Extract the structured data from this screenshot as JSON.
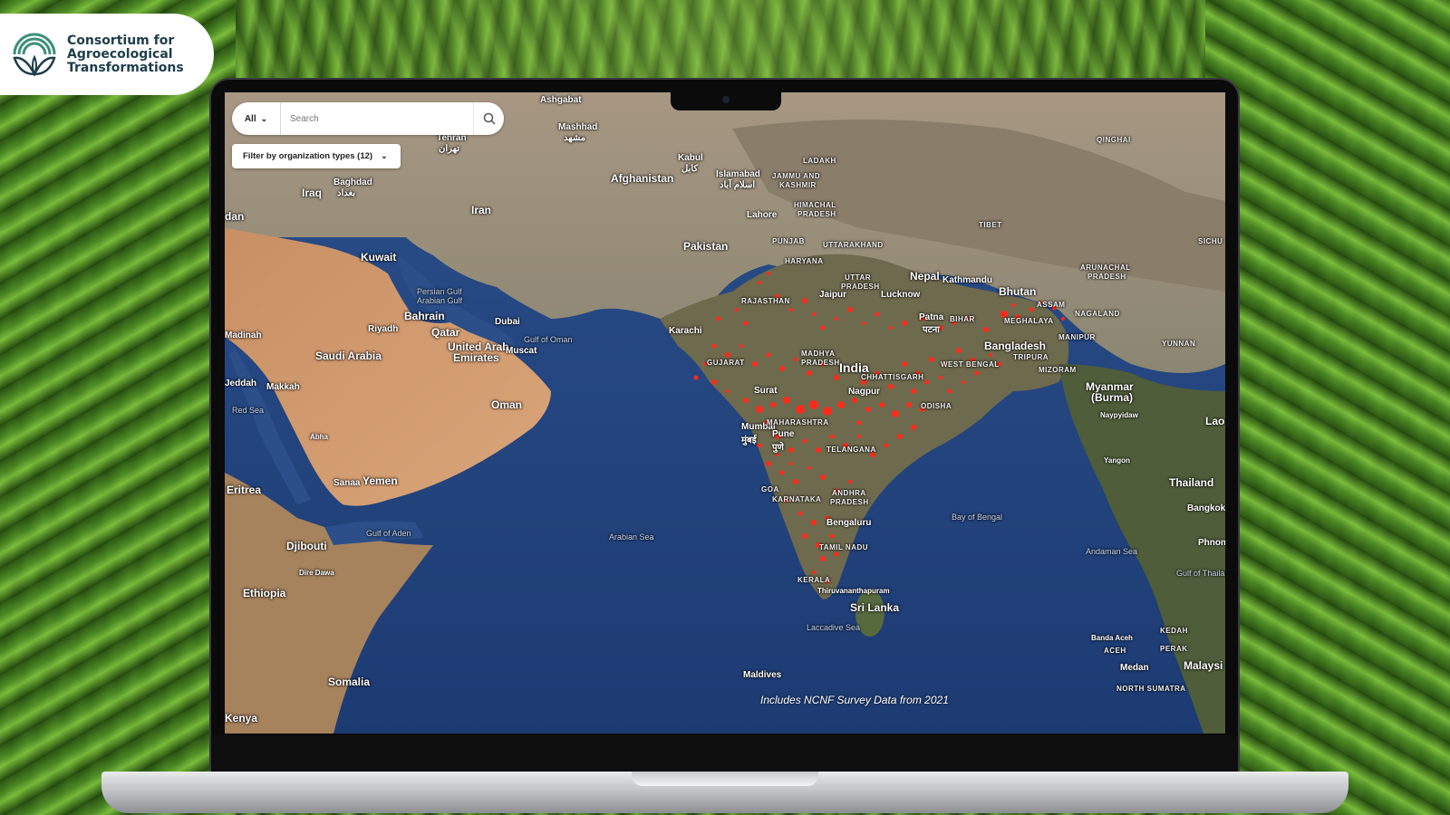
{
  "brand": {
    "logo_icon": "arch-leaf-logo",
    "line1": "Consortium for",
    "line2": "Agroecological",
    "line3": "Transformations",
    "color": "#1e3d4a"
  },
  "search": {
    "scope_label": "All",
    "placeholder": "Search",
    "value": ""
  },
  "filter": {
    "label": "Filter by organization types (12)"
  },
  "map": {
    "note": "Includes NCNF Survey Data from 2021",
    "marker_color": "#ff2a1a",
    "labels": {
      "ashgabat": "Ashgabat",
      "mashhad": "Mashhad",
      "mashhad_local": "مشهد",
      "tehran": "Tehran",
      "tehran_local": "تهران",
      "baghdad": "Baghdad",
      "baghdad_local": "بغداد",
      "iraq": "Iraq",
      "dan": "dan",
      "iran": "Iran",
      "afghanistan": "Afghanistan",
      "kabul": "Kabul",
      "kabul_local": "کابل",
      "islamabad": "Islamabad",
      "islamabad_local": "اسلام آباد",
      "jammu": "JAMMU AND",
      "kashmir": "KASHMIR",
      "ladakh": "LADAKH",
      "qinghai": "QINGHAI",
      "lahore": "Lahore",
      "himachal": "HIMACHAL",
      "pradesh_hp": "PRADESH",
      "tibet": "TIBET",
      "kuwait": "Kuwait",
      "pakistan": "Pakistan",
      "punjab": "PUNJAB",
      "uttarakhand": "UTTARAKHAND",
      "haryana": "HARYANA",
      "sichuan": "SICHU",
      "persian_gulf": "Persian Gulf",
      "arabian_gulf": "Arabian Gulf",
      "bahrain": "Bahrain",
      "nepal": "Nepal",
      "kathmandu": "Kathmandu",
      "bhutan": "Bhutan",
      "arunachal": "ARUNACHAL",
      "pradesh_ar": "PRADESH",
      "jaipur": "Jaipur",
      "lucknow": "Lucknow",
      "rajasthan": "RAJASTHAN",
      "uttar": "UTTAR",
      "pradesh_up": "PRADESH",
      "assam": "ASSAM",
      "nagaland": "NAGALAND",
      "meghalaya": "MEGHALAYA",
      "patna": "Patna",
      "patna_local": "पटना",
      "bihar": "BIHAR",
      "madinah": "Madinah",
      "riyadh": "Riyadh",
      "dubai": "Dubai",
      "qatar": "Qatar",
      "karachi": "Karachi",
      "gulf_oman": "Gulf of Oman",
      "uae1": "United Arab",
      "uae2": "Emirates",
      "muscat": "Muscat",
      "gujarat": "GUJARAT",
      "madhya": "MADHYA",
      "pradesh_mp": "PRADESH",
      "bangladesh": "Bangladesh",
      "manipur": "MANIPUR",
      "yunnan": "YUNNAN",
      "saudi": "Saudi Arabia",
      "india": "India",
      "west_bengal": "WEST BENGAL",
      "tripura": "TRIPURA",
      "mizoram": "MIZORAM",
      "chhattisgarh": "CHHATTISGARH",
      "jeddah": "Jeddah",
      "makkah": "Makkah",
      "surat": "Surat",
      "nagpur": "Nagpur",
      "myanmar1": "Myanmar",
      "myanmar2": "(Burma)",
      "oman": "Oman",
      "red_sea": "Red Sea",
      "odisha": "ODISHA",
      "mumbai": "Mumbai",
      "mumbai_local": "मुंबई",
      "maharashtra": "MAHARASHTRA",
      "naypyidaw": "Naypyidaw",
      "laos": "Lao",
      "pune": "Pune",
      "pune_local": "पुणे",
      "telangana": "TELANGANA",
      "abha": "Abha",
      "yangon": "Yangon",
      "eritrea": "Eritrea",
      "sanaa": "Sanaa",
      "yemen": "Yemen",
      "goa": "GOA",
      "karnataka": "KARNATAKA",
      "andhra": "ANDHRA",
      "pradesh_ap": "PRADESH",
      "thailand": "Thailand",
      "bangkok": "Bangkok",
      "bay_bengal": "Bay of Bengal",
      "gulf_aden": "Gulf of Aden",
      "arabian_sea": "Arabian Sea",
      "bengaluru": "Bengaluru",
      "djibouti": "Djibouti",
      "andaman_sea": "Andaman Sea",
      "phnom": "Phnom",
      "tamil_nadu": "TAMIL NADU",
      "dire_dawa": "Dire Dawa",
      "gulf_thailand": "Gulf of Thailand",
      "kerala": "KERALA",
      "ethiopia": "Ethiopia",
      "thiruvananthapuram": "Thiruvananthapuram",
      "sri_lanka": "Sri Lanka",
      "kedah": "KEDAH",
      "laccadive": "Laccadive Sea",
      "banda_aceh": "Banda Aceh",
      "perak": "PERAK",
      "aceh": "ACEH",
      "medan": "Medan",
      "malaysia": "Malaysi",
      "maldives": "Maldives",
      "somalia": "Somalia",
      "north_sumatra": "NORTH SUMATRA",
      "kenya": "Kenya"
    }
  }
}
